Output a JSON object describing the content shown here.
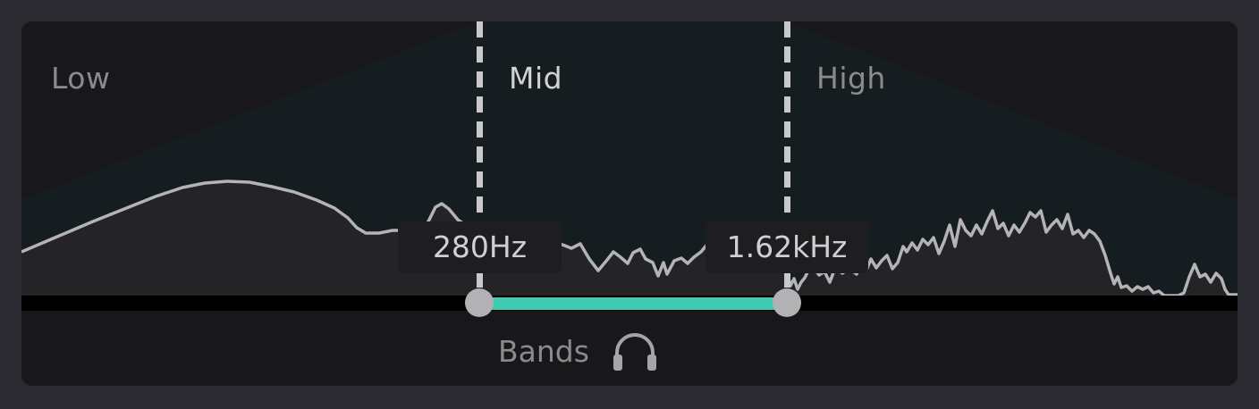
{
  "bands": {
    "low_label": "Low",
    "mid_label": "Mid",
    "high_label": "High"
  },
  "crossovers": {
    "low_mid": "280Hz",
    "mid_high": "1.62kHz"
  },
  "footer": {
    "label": "Bands",
    "icon": "headphones-icon"
  },
  "colors": {
    "background": "#2c2b31",
    "panel": "#18181a",
    "accent": "#3fcab1",
    "spectrum_line": "#b4b4b6"
  }
}
